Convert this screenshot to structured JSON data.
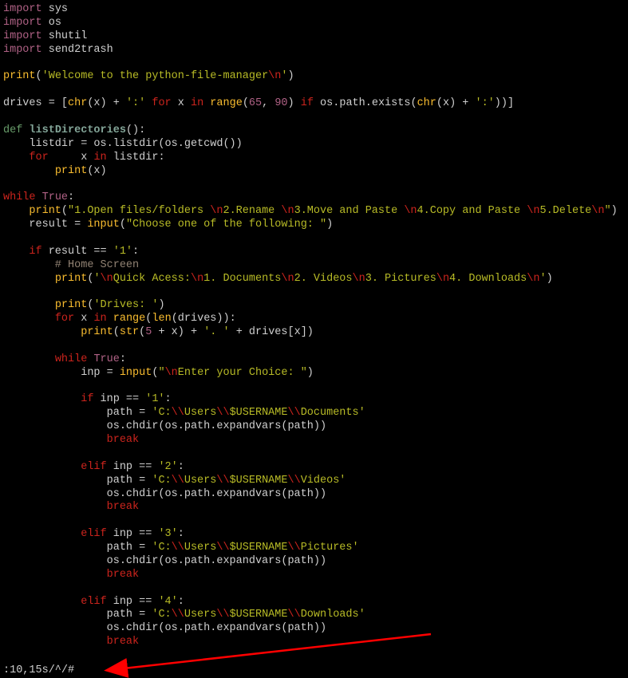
{
  "imports": [
    "sys",
    "os",
    "shutil",
    "send2trash"
  ],
  "printWelcome": {
    "text": "'Welcome to the python-file-manager",
    "esc": "\\n",
    "close": "'"
  },
  "drivesLine": {
    "ch1": "(x) + ",
    "s1": "':'",
    "for": " x ",
    "in": " ",
    "builtin": "range",
    "args": "(",
    "n1": "65",
    "comma": ", ",
    "n2": "90",
    "close": ") ",
    "if": " os.path.exists(",
    "chr2": "(x) + ",
    "s2": "':'",
    "end": "))]"
  },
  "defName": "listDirectories",
  "listdirLine": "    listdir = os.listdir(os.getcwd())",
  "forX": "     x ",
  "inList": " listdir:",
  "printX": "(x)",
  "menu": {
    "p1": "\"1.Open files/folders ",
    "e1": "\\n",
    "p2": "2.Rename ",
    "e2": "\\n",
    "p3": "3.Move and Paste ",
    "e3": "\\n",
    "p4": "4.Copy and Paste ",
    "e4": "\\n",
    "p5": "5.Delete",
    "e5": "\\n",
    "close": "\""
  },
  "resultEq": "    result = ",
  "inputPrompt": "\"Choose one of the following: \"",
  "r1": "'1'",
  "homeComment": "        # Home Screen",
  "qaccess": {
    "s1": "'",
    "e1": "\\n",
    "s2": "Quick Acess:",
    "e2": "\\n",
    "s3": "1. Documents",
    "e3": "\\n",
    "s4": "2. Videos",
    "e4": "\\n",
    "s5": "3. Pictures",
    "e5": "\\n",
    "s6": "4. Downloads",
    "e6": "\\n",
    "close": "'"
  },
  "drivesLabel": "'Drives: '",
  "forRangeDrives": "(drives)):",
  "five": "5",
  "dotSpace": "'. '",
  "plusDrives": " + drives[x])",
  "inpEq": "            inp = ",
  "enterChoice": {
    "s1": "\"",
    "e1": "\\n",
    "s2": "Enter your Choice: \""
  },
  "n1": "'1'",
  "n2": "'2'",
  "n3": "'3'",
  "n4": "'4'",
  "paths": {
    "docs": {
      "a": "'C:",
      "b": "\\\\",
      "c": "Users",
      "d": "\\\\",
      "e": "$USERNAME",
      "f": "\\\\",
      "g": "Documents'"
    },
    "vids": {
      "a": "'C:",
      "b": "\\\\",
      "c": "Users",
      "d": "\\\\",
      "e": "$USERNAME",
      "f": "\\\\",
      "g": "Videos'"
    },
    "pics": {
      "a": "'C:",
      "b": "\\\\",
      "c": "Users",
      "d": "\\\\",
      "e": "$USERNAME",
      "f": "\\\\",
      "g": "Pictures'"
    },
    "down": {
      "a": "'C:",
      "b": "\\\\",
      "c": "Users",
      "d": "\\\\",
      "e": "$USERNAME",
      "f": "\\\\",
      "g": "Downloads'"
    }
  },
  "chdir": "                os.chdir(os.path.expandvars(path))",
  "pathEq": "                path = ",
  "cmdline": ":10,15s/^/#"
}
